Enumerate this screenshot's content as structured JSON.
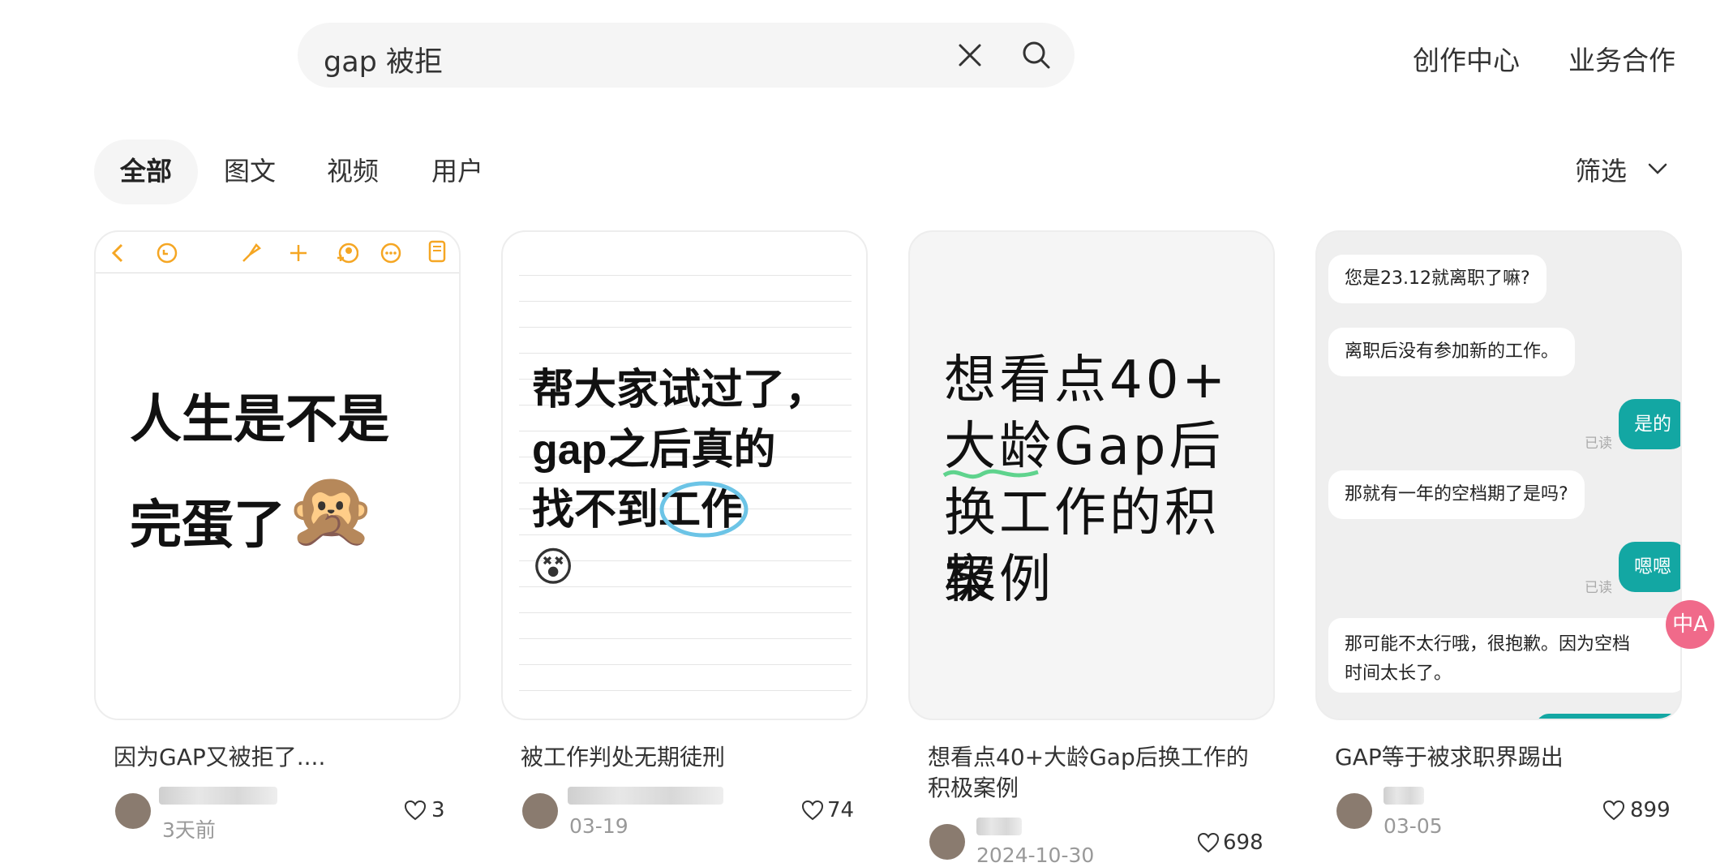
{
  "search": {
    "query": "gap 被拒"
  },
  "header": {
    "links": [
      "创作中心",
      "业务合作"
    ]
  },
  "tabs": [
    {
      "label": "全部",
      "active": true
    },
    {
      "label": "图文"
    },
    {
      "label": "视频"
    },
    {
      "label": "用户"
    }
  ],
  "filter": {
    "label": "筛选"
  },
  "cards": [
    {
      "cover_lines": [
        "人生是不是",
        "完蛋了"
      ],
      "cover_emoji": "🙊",
      "title": "因为GAP又被拒了....",
      "date": "3天前",
      "likes": "3"
    },
    {
      "cover_lines": [
        "帮大家试过了，",
        "gap之后真的",
        "找不到工作"
      ],
      "cover_emoji": "😵",
      "title": "被工作判处无期徒刑",
      "date": "03-19",
      "likes": "74"
    },
    {
      "cover_lines": [
        "想看点40+",
        "大龄Gap后",
        "换工作的积极",
        "案例"
      ],
      "title": "想看点40+大龄Gap后换工作的积极案例",
      "title_lines": [
        "想看点40+大龄Gap后换工作的",
        "积极案例"
      ],
      "date": "2024-10-30",
      "likes": "698"
    },
    {
      "chat": {
        "msg1": "您是23.12就离职了嘛?",
        "msg2": "离职后没有参加新的工作。",
        "reply1": "是的",
        "read": "已读",
        "msg3": "那就有一年的空档期了是吗?",
        "reply2": "嗯嗯",
        "msg4_line1": "那可能不太行哦，很抱歉。因为空档",
        "msg4_line2": "时间太长了。"
      },
      "title": "GAP等于被求职界踢出",
      "date": "03-05",
      "likes": "899"
    }
  ],
  "translate_btn": "中A"
}
